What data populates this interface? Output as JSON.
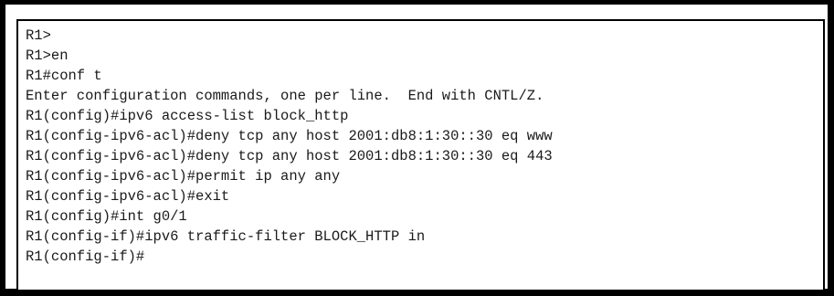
{
  "terminal": {
    "lines": [
      "R1>",
      "R1>en",
      "R1#conf t",
      "Enter configuration commands, one per line.  End with CNTL/Z.",
      "R1(config)#ipv6 access-list block_http",
      "R1(config-ipv6-acl)#deny tcp any host 2001:db8:1:30::30 eq www",
      "R1(config-ipv6-acl)#deny tcp any host 2001:db8:1:30::30 eq 443",
      "R1(config-ipv6-acl)#permit ip any any",
      "R1(config-ipv6-acl)#exit",
      "R1(config)#int g0/1",
      "R1(config-if)#ipv6 traffic-filter BLOCK_HTTP in",
      "R1(config-if)#"
    ]
  }
}
